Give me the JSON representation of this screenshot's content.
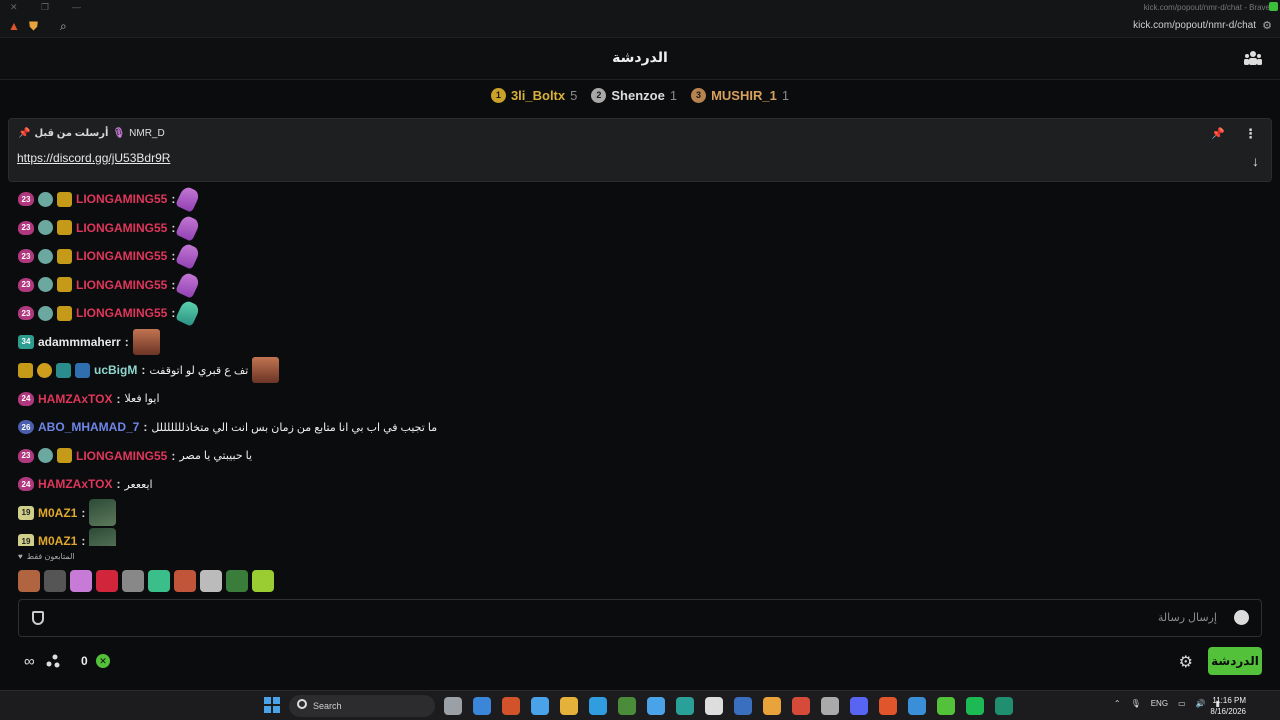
{
  "browser": {
    "window_title": "kick.com/popout/nmr-d/chat - Brave",
    "url": "kick.com/popout/nmr-d/chat"
  },
  "header": {
    "title": "الدردشة"
  },
  "leaderboard": [
    {
      "rank": "1",
      "name": "3li_Boltx",
      "count": "5",
      "rank_color": "#c9a227",
      "name_color": "#d8b13a"
    },
    {
      "rank": "2",
      "name": "Shenzoe",
      "count": "1",
      "rank_color": "#a8a8a8",
      "name_color": "#dcdcdc"
    },
    {
      "rank": "3",
      "name": "MUSHIR_1",
      "count": "1",
      "rank_color": "#b7834f",
      "name_color": "#d8a05e"
    }
  ],
  "pinned": {
    "label": "أرسلت من قبل",
    "author": "NMR_D",
    "link": "https://discord.gg/jU53Bdr9R"
  },
  "messages": [
    {
      "level": "23",
      "level_style": "pink",
      "badges": [
        "vip",
        "crown"
      ],
      "user": "LIONGAMING55",
      "user_color": "#e0365c",
      "text": "",
      "emote": "glove"
    },
    {
      "level": "23",
      "level_style": "pink",
      "badges": [
        "vip",
        "crown"
      ],
      "user": "LIONGAMING55",
      "user_color": "#e0365c",
      "text": "",
      "emote": "glove"
    },
    {
      "level": "23",
      "level_style": "pink",
      "badges": [
        "vip",
        "crown"
      ],
      "user": "LIONGAMING55",
      "user_color": "#e0365c",
      "text": "",
      "emote": "glove"
    },
    {
      "level": "23",
      "level_style": "pink",
      "badges": [
        "vip",
        "crown"
      ],
      "user": "LIONGAMING55",
      "user_color": "#e0365c",
      "text": "",
      "emote": "glove"
    },
    {
      "level": "23",
      "level_style": "pink",
      "badges": [
        "vip",
        "crown"
      ],
      "user": "LIONGAMING55",
      "user_color": "#e0365c",
      "text": "",
      "emote": "glove-green"
    },
    {
      "level": "34",
      "level_style": "teal",
      "badges": [],
      "user": "adammmaherr",
      "user_color": "#e8e8e8",
      "text": "",
      "emote": "face"
    },
    {
      "level": "",
      "level_style": "",
      "badges": [
        "crown",
        "coin",
        "kick",
        "hammer"
      ],
      "user": "ucBigM",
      "user_color": "#8fd8d0",
      "text": "تف ع قبري لو اتوقفت",
      "emote": "face"
    },
    {
      "level": "24",
      "level_style": "pink",
      "badges": [],
      "user": "HAMZAxTOX",
      "user_color": "#e0365c",
      "text": "ايوا فعلا",
      "emote": ""
    },
    {
      "level": "26",
      "level_style": "blue",
      "badges": [],
      "user": "ABO_MHAMAD_7",
      "user_color": "#6f86e8",
      "text": "ما تجيب في اب بي انا متابع من زمان بس انت الي متخاذلللللللل",
      "emote": ""
    },
    {
      "level": "23",
      "level_style": "pink",
      "badges": [
        "vip",
        "crown"
      ],
      "user": "LIONGAMING55",
      "user_color": "#e0365c",
      "text": "يا حبيبتي يا مصر",
      "emote": ""
    },
    {
      "level": "24",
      "level_style": "pink",
      "badges": [],
      "user": "HAMZAxTOX",
      "user_color": "#e0365c",
      "text": "ايعععر",
      "emote": ""
    },
    {
      "level": "19",
      "level_style": "gold",
      "badges": [],
      "user": "M0AZ1",
      "user_color": "#e0a82e",
      "text": "",
      "emote": "dark"
    },
    {
      "level": "19",
      "level_style": "gold",
      "badges": [],
      "user": "M0AZ1",
      "user_color": "#e0a82e",
      "text": "",
      "emote": "dark"
    }
  ],
  "emotes": {
    "label": "المتابعون فقط",
    "items": [
      "#b0643f",
      "#555",
      "#c77bd6",
      "#d0253b",
      "#888",
      "#3bbf8a",
      "#c0553a",
      "#bbb",
      "#3a7d3a",
      "#9acd32"
    ]
  },
  "input": {
    "placeholder": "إرسال رسالة"
  },
  "bottom": {
    "points": "0",
    "send_label": "الدردشة"
  },
  "taskbar": {
    "search_label": "Search",
    "lang": "ENG",
    "time": "11:16 PM",
    "date": "8/16/2026",
    "apps": [
      "#9aa0a6",
      "#3a86d8",
      "#d2532b",
      "#4aa3e8",
      "#e4b23a",
      "#2f9de0",
      "#4a8c3a",
      "#4aa3e8",
      "#2aa198",
      "#ddd",
      "#3a6fc0",
      "#e8a33a",
      "#d64a3a",
      "#aaa",
      "#5865f2",
      "#e0552b",
      "#3a8fd8",
      "#53c13a",
      "#1db954",
      "#1f8f6f"
    ]
  }
}
